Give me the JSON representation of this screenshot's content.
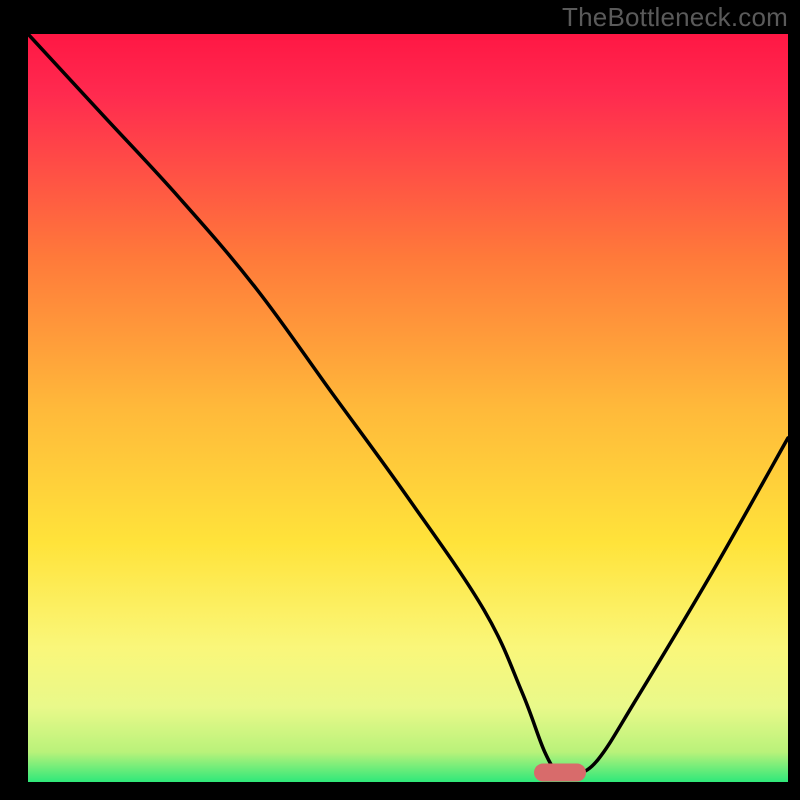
{
  "watermark": "TheBottleneck.com",
  "chart_data": {
    "type": "line",
    "title": "",
    "xlabel": "",
    "ylabel": "",
    "xlim": [
      0,
      100
    ],
    "ylim": [
      0,
      100
    ],
    "series": [
      {
        "name": "bottleneck-curve",
        "x": [
          0,
          10,
          20,
          30,
          40,
          50,
          60,
          65,
          68,
          70,
          72,
          75,
          80,
          90,
          100
        ],
        "values": [
          100,
          89,
          78,
          66,
          52,
          38,
          23,
          12,
          4,
          1,
          1,
          3,
          11,
          28,
          46
        ]
      }
    ],
    "marker": {
      "x": 70,
      "y": 1,
      "color": "#d86b6b"
    },
    "gradient_stops": [
      {
        "offset": 0,
        "color": "#ff1744"
      },
      {
        "offset": 0.08,
        "color": "#ff2a4f"
      },
      {
        "offset": 0.3,
        "color": "#ff7a3a"
      },
      {
        "offset": 0.5,
        "color": "#ffb93a"
      },
      {
        "offset": 0.68,
        "color": "#ffe33a"
      },
      {
        "offset": 0.82,
        "color": "#faf77a"
      },
      {
        "offset": 0.9,
        "color": "#e9f98a"
      },
      {
        "offset": 0.96,
        "color": "#b9f27a"
      },
      {
        "offset": 1.0,
        "color": "#2fe87a"
      }
    ]
  }
}
